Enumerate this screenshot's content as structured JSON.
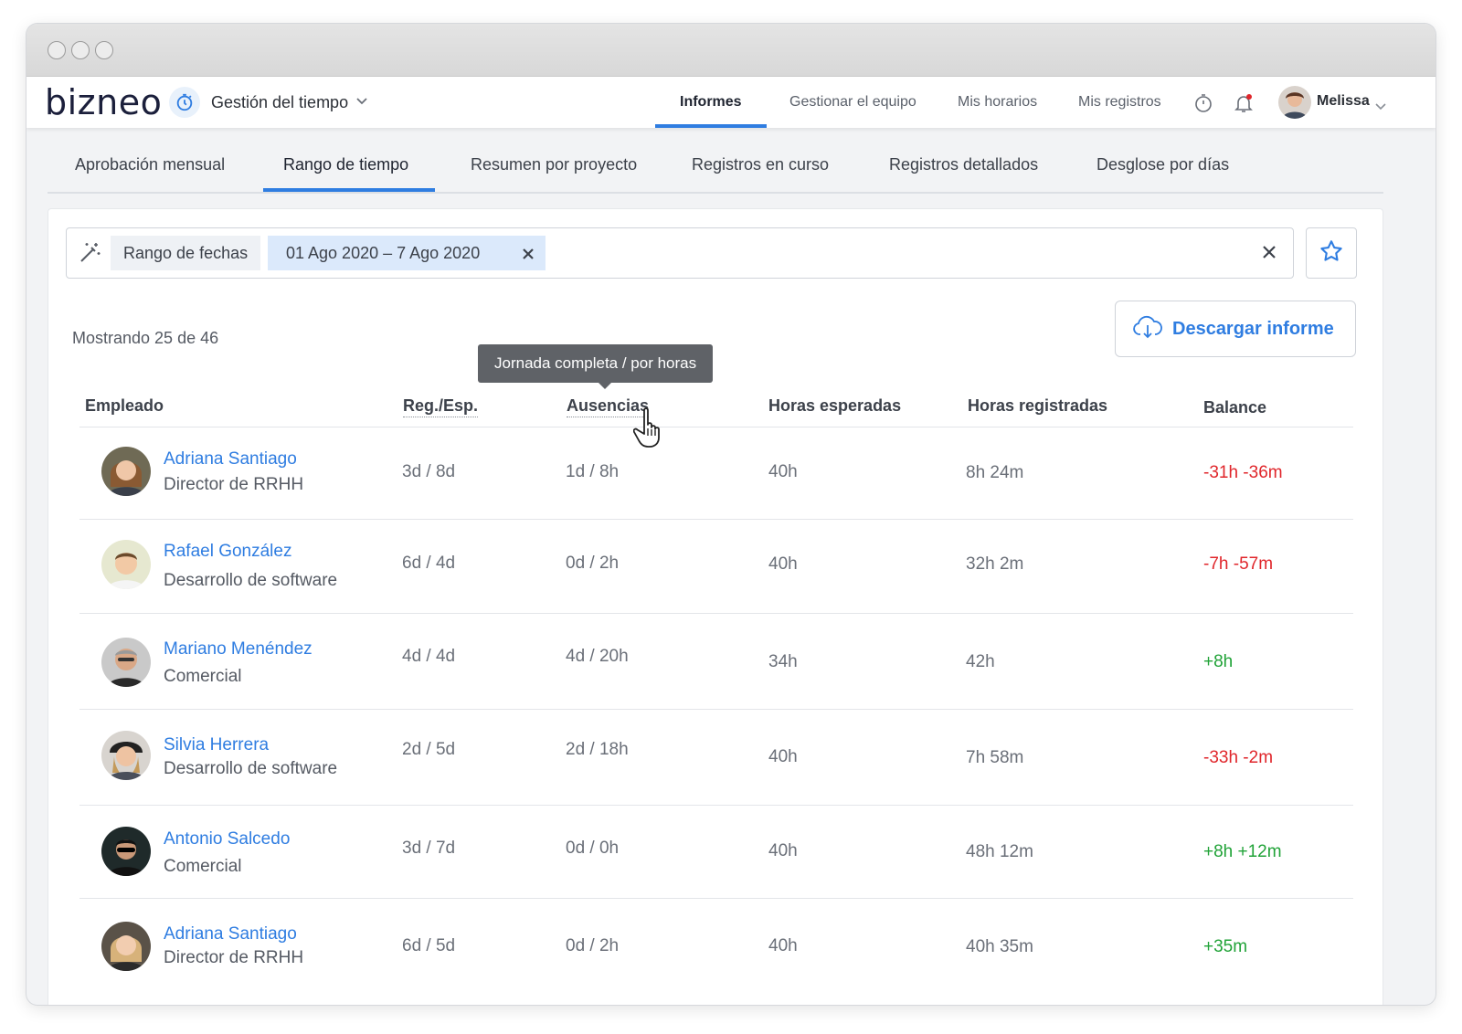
{
  "app": {
    "logo": "bizneo",
    "module": "Gestión del tiempo"
  },
  "topnav": [
    {
      "label": "Informes",
      "active": true
    },
    {
      "label": "Gestionar el equipo"
    },
    {
      "label": "Mis horarios"
    },
    {
      "label": "Mis registros"
    }
  ],
  "user": {
    "name": "Melissa"
  },
  "subtabs": [
    {
      "label": "Aprobación mensual"
    },
    {
      "label": "Rango de tiempo",
      "active": true
    },
    {
      "label": "Resumen por proyecto"
    },
    {
      "label": "Registros en curso"
    },
    {
      "label": "Registros detallados"
    },
    {
      "label": "Desglose por días"
    }
  ],
  "filter": {
    "label": "Rango de fechas",
    "value": "01 Ago 2020 – 7 Ago 2020"
  },
  "showing": "Mostrando 25 de 46",
  "download_label": "Descargar informe",
  "tooltip": "Jornada completa / por horas",
  "columns": {
    "employee": "Empleado",
    "reg": "Reg./Esp.",
    "absences": "Ausencias",
    "expected": "Horas esperadas",
    "registered": "Horas registradas",
    "balance": "Balance"
  },
  "colors": {
    "accent": "#2f7de1",
    "negative": "#e0262b",
    "positive": "#21a338"
  },
  "rows": [
    {
      "name": "Adriana Santiago",
      "role": "Director de RRHH",
      "reg": "3d / 8d",
      "abs": "1d / 8h",
      "expected": "40h",
      "registered": "8h 24m",
      "balance": "-31h -36m",
      "balance_sign": "negative"
    },
    {
      "name": "Rafael González",
      "role": "Desarrollo de software",
      "reg": "6d / 4d",
      "abs": "0d / 2h",
      "expected": "40h",
      "registered": "32h 2m",
      "balance": "-7h -57m",
      "balance_sign": "negative"
    },
    {
      "name": "Mariano Menéndez",
      "role": "Comercial",
      "reg": "4d / 4d",
      "abs": "4d / 20h",
      "expected": "34h",
      "registered": "42h",
      "balance": "+8h",
      "balance_sign": "positive"
    },
    {
      "name": "Silvia Herrera",
      "role": "Desarrollo de software",
      "reg": "2d / 5d",
      "abs": "2d / 18h",
      "expected": "40h",
      "registered": "7h 58m",
      "balance": "-33h -2m",
      "balance_sign": "negative"
    },
    {
      "name": "Antonio Salcedo",
      "role": "Comercial",
      "reg": "3d / 7d",
      "abs": "0d / 0h",
      "expected": "40h",
      "registered": "48h 12m",
      "balance": "+8h +12m",
      "balance_sign": "positive"
    },
    {
      "name": "Adriana Santiago",
      "role": "Director de RRHH",
      "reg": "6d / 5d",
      "abs": "0d / 2h",
      "expected": "40h",
      "registered": "40h 35m",
      "balance": "+35m",
      "balance_sign": "positive"
    }
  ]
}
